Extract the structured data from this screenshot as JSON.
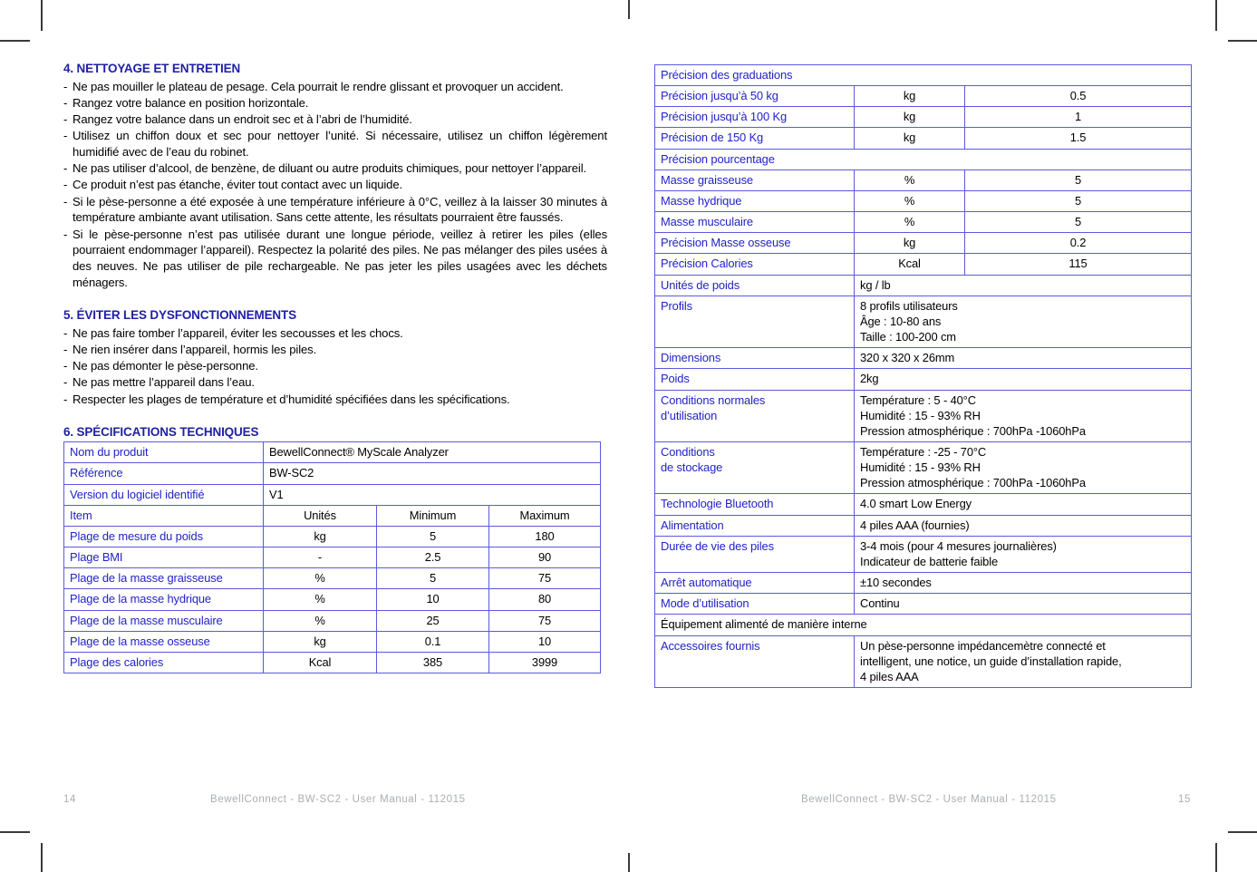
{
  "document": {
    "language": "fr",
    "brand_blue": "#2222c8",
    "heading_blue": "#1f1fa5",
    "table_border": "#5a5ae0",
    "footer_gray": "#a9aeb4"
  },
  "left_page": {
    "sections": [
      {
        "heading": "4. NETTOYAGE ET ENTRETIEN",
        "bullets": [
          "Ne pas mouiller le plateau de pesage. Cela pourrait le rendre glissant et provoquer un accident.",
          "Rangez votre balance en position horizontale.",
          "Rangez votre balance dans un endroit sec et à l’abri de l’humidité.",
          "Utilisez un chiffon doux et sec pour nettoyer l’unité. Si nécessaire, utilisez un chiffon légèrement humidifié avec de l’eau du robinet.",
          "Ne pas utiliser d’alcool, de benzène, de diluant ou autre produits chimiques, pour nettoyer l’appareil.",
          "Ce produit n’est pas étanche, éviter tout contact avec un liquide.",
          "Si le pèse-personne a été exposée à une température inférieure à 0°C, veillez à la laisser 30 minutes à température ambiante avant utilisation. Sans cette attente, les résultats pourraient être faussés.",
          "Si le pèse-personne n’est pas utilisée durant une longue période, veillez à retirer les piles (elles pourraient endommager l’appareil). Respectez la polarité des piles. Ne pas mélanger des piles usées à des neuves. Ne pas utiliser de pile rechargeable. Ne pas jeter les piles usagées avec les déchets ménagers."
        ]
      },
      {
        "heading": "5. ÉVITER LES DYSFONCTIONNEMENTS",
        "bullets": [
          "Ne pas faire tomber l’appareil, éviter les secousses et les chocs.",
          "Ne rien insérer dans l’appareil, hormis les piles.",
          "Ne pas démonter le pèse-personne.",
          "Ne pas mettre l’appareil dans l’eau.",
          "Respecter les plages de température et d’humidité spécifiées dans les spécifications."
        ]
      },
      {
        "heading": "6. SPÉCIFICATIONS TECHNIQUES",
        "bullets": []
      }
    ],
    "spec_table": {
      "rows": [
        {
          "type": "pair",
          "label": "Nom du produit",
          "value": "BewellConnect® MyScale Analyzer"
        },
        {
          "type": "pair",
          "label": "Référence",
          "value": "BW-SC2"
        },
        {
          "type": "pair",
          "label": "Version du logiciel identifié",
          "value": "V1"
        },
        {
          "type": "header",
          "label": "Item",
          "units": "Unités",
          "min": "Minimum",
          "max": "Maximum"
        },
        {
          "type": "quad",
          "label": "Plage de mesure du poids",
          "units": "kg",
          "min": "5",
          "max": "180"
        },
        {
          "type": "quad",
          "label": "Plage BMI",
          "units": "-",
          "min": "2.5",
          "max": "90"
        },
        {
          "type": "quad",
          "label": "Plage de la masse graisseuse",
          "units": "%",
          "min": "5",
          "max": "75"
        },
        {
          "type": "quad",
          "label": "Plage de la masse hydrique",
          "units": "%",
          "min": "10",
          "max": "80"
        },
        {
          "type": "quad",
          "label": "Plage de la masse musculaire",
          "units": "%",
          "min": "25",
          "max": "75"
        },
        {
          "type": "quad",
          "label": "Plage de la masse osseuse",
          "units": "kg",
          "min": "0.1",
          "max": "10"
        },
        {
          "type": "quad",
          "label": "Plage des calories",
          "units": "Kcal",
          "min": "385",
          "max": "3999"
        }
      ]
    },
    "footer": {
      "page_number": "14",
      "text": "BewellConnect - BW-SC2 - User Manual - 112015"
    }
  },
  "right_page": {
    "spec_table": {
      "rows": [
        {
          "type": "section",
          "label": "Précision des graduations"
        },
        {
          "type": "triple",
          "label": "Précision jusqu’à 50 kg",
          "units": "kg",
          "value": "0.5"
        },
        {
          "type": "triple",
          "label": "Précision jusqu’à 100 Kg",
          "units": "kg",
          "value": "1"
        },
        {
          "type": "triple",
          "label": "Précision de 150 Kg",
          "units": "kg",
          "value": "1.5"
        },
        {
          "type": "section",
          "label": "Précision pourcentage"
        },
        {
          "type": "triple",
          "label": "Masse graisseuse",
          "units": "%",
          "value": "5"
        },
        {
          "type": "triple",
          "label": "Masse hydrique",
          "units": "%",
          "value": "5"
        },
        {
          "type": "triple",
          "label": "Masse musculaire",
          "units": "%",
          "value": "5"
        },
        {
          "type": "triple",
          "label": "Précision Masse osseuse",
          "units": "kg",
          "value": "0.2"
        },
        {
          "type": "triple",
          "label": "Précision Calories",
          "units": "Kcal",
          "value": "115"
        },
        {
          "type": "pair",
          "label": "Unités de poids",
          "value": "kg / lb"
        },
        {
          "type": "pair",
          "label": "Profils",
          "value": "8 profils utilisateurs\nÂge : 10-80 ans\nTaille : 100-200 cm"
        },
        {
          "type": "pair",
          "label": "Dimensions",
          "value": "320 x 320 x 26mm"
        },
        {
          "type": "pair",
          "label": "Poids",
          "value": "2kg"
        },
        {
          "type": "pair",
          "label": "Conditions normales\nd’utilisation",
          "value": "Température : 5 - 40°C\nHumidité : 15 - 93% RH\nPression atmosphérique : 700hPa -1060hPa"
        },
        {
          "type": "pair",
          "label": "Conditions\nde stockage",
          "value": "Température : -25 - 70°C\nHumidité : 15 - 93% RH\nPression atmosphérique : 700hPa -1060hPa"
        },
        {
          "type": "pair",
          "label": "Technologie  Bluetooth",
          "value": "4.0 smart Low Energy"
        },
        {
          "type": "pair",
          "label": "Alimentation",
          "value": "4 piles AAA (fournies)"
        },
        {
          "type": "pair",
          "label": "Durée de vie des piles",
          "value": "3-4 mois (pour 4 mesures journalières)\nIndicateur de batterie faible"
        },
        {
          "type": "pair",
          "label": "Arrêt automatique",
          "value": "±10 secondes"
        },
        {
          "type": "pair",
          "label": "Mode d’utilisation",
          "value": "Continu"
        },
        {
          "type": "section_black",
          "label": "Équipement alimenté de manière interne"
        },
        {
          "type": "pair",
          "label": "Accessoires fournis",
          "value": "Un pèse-personne impédancemètre connecté et\nintelligent, une notice, un guide d’installation rapide,\n4 piles AAA"
        }
      ]
    },
    "footer": {
      "page_number": "15",
      "text": "BewellConnect - BW-SC2 - User Manual - 112015"
    }
  }
}
